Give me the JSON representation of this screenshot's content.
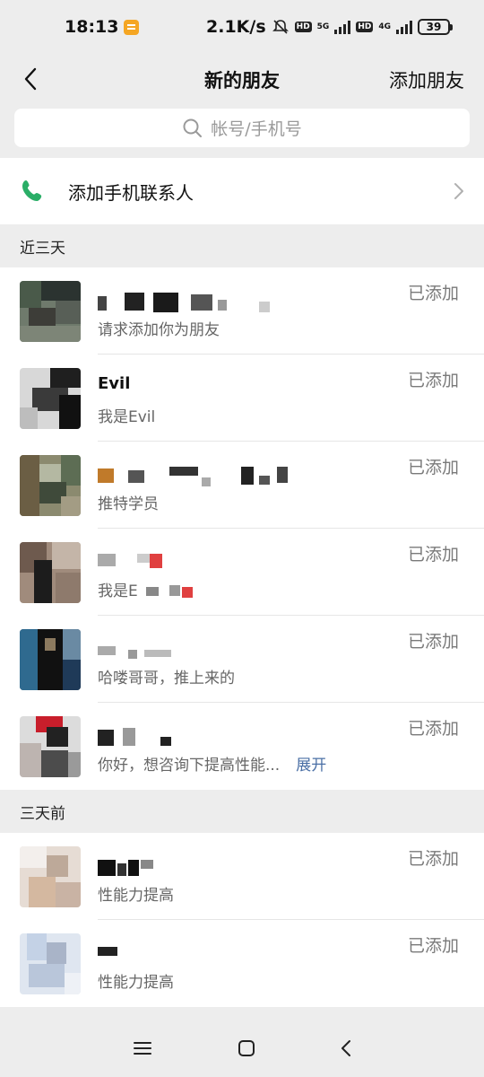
{
  "status_bar": {
    "time": "18:13",
    "net_speed": "2.1K/s",
    "hd1": "HD",
    "net1": "5G",
    "hd2": "HD",
    "net2": "4G",
    "battery": "39"
  },
  "nav": {
    "title": "新的朋友",
    "action": "添加朋友"
  },
  "search": {
    "placeholder": "帐号/手机号"
  },
  "add_contacts": {
    "label": "添加手机联系人"
  },
  "sections": [
    {
      "header": "近三天",
      "items": [
        {
          "name": "",
          "message": "请求添加你为朋友",
          "status": "已添加"
        },
        {
          "name": "Evil",
          "message": "我是Evil",
          "status": "已添加"
        },
        {
          "name": "",
          "message": "推特学员",
          "status": "已添加"
        },
        {
          "name": "",
          "message": "我是E",
          "status": "已添加"
        },
        {
          "name": "",
          "message": "哈喽哥哥，推上来的",
          "status": "已添加"
        },
        {
          "name": "",
          "message": "你好，想咨询下提高性能...",
          "expand": "展开",
          "status": "已添加"
        }
      ]
    },
    {
      "header": "三天前",
      "items": [
        {
          "name": "",
          "message": "性能力提高",
          "status": "已添加"
        },
        {
          "name": "",
          "message": "性能力提高",
          "status": "已添加"
        }
      ]
    }
  ],
  "colors": {
    "phone_icon": "#2aae67",
    "link": "#4a6fa5",
    "background": "#ededed"
  },
  "icons": {
    "back": "back-arrow-icon",
    "search": "search-icon",
    "phone": "phone-icon",
    "chevron": "chevron-right-icon",
    "menu": "menu-icon",
    "home": "home-icon",
    "system_back": "system-back-icon"
  }
}
